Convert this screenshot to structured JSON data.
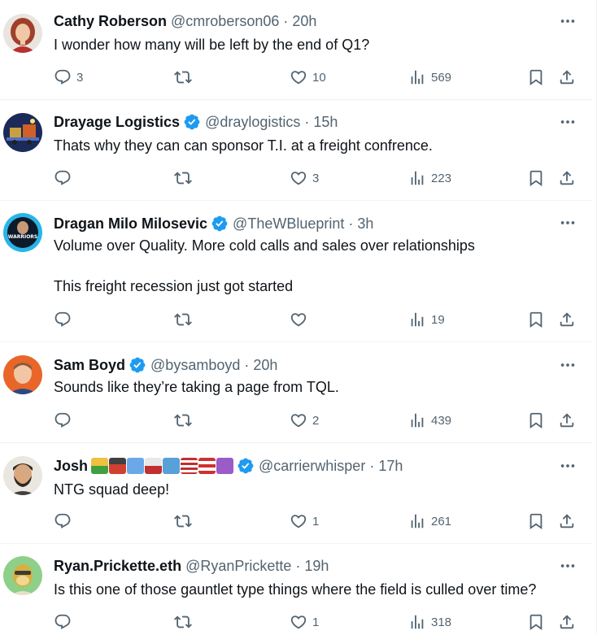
{
  "tweets": [
    {
      "name": "Cathy Roberson",
      "handle": "@cmroberson06",
      "dot": "·",
      "time": "20h",
      "verified": false,
      "text_lines": [
        "I wonder how many will be left by the end of Q1?"
      ],
      "replies": "3",
      "retweets": "",
      "likes": "10",
      "views": "569",
      "avatar": "woman-red-hair-avatar"
    },
    {
      "name": "Drayage Logistics",
      "handle": "@draylogistics",
      "dot": "·",
      "time": "15h",
      "verified": true,
      "text_lines": [
        "Thats why they can can sponsor T.I. at a freight confrence."
      ],
      "replies": "",
      "retweets": "",
      "likes": "3",
      "views": "223",
      "avatar": "trucks-night-avatar"
    },
    {
      "name": "Dragan Milo Milosevic",
      "handle": "@TheWBlueprint",
      "dot": "·",
      "time": "3h",
      "verified": true,
      "text_lines": [
        "Volume over Quality. More cold calls and sales over relationships",
        "",
        "This freight recession just got started"
      ],
      "replies": "",
      "retweets": "",
      "likes": "",
      "views": "19",
      "avatar": "warriors-blueprint-avatar"
    },
    {
      "name": "Sam Boyd",
      "handle": "@bysamboyd",
      "dot": "·",
      "time": "20h",
      "verified": true,
      "text_lines": [
        "Sounds like they’re taking a page from TQL."
      ],
      "replies": "",
      "retweets": "",
      "likes": "2",
      "views": "439",
      "avatar": "man-orange-background-avatar"
    },
    {
      "name": "Josh",
      "handle": "@carrierwhisper",
      "dot": "·",
      "time": "17h",
      "verified": true,
      "emoji": [
        "truck",
        "train",
        "airplane",
        "ship",
        "robot",
        "us-flag",
        "puerto-rico-flag",
        "latin-cross"
      ],
      "text_lines": [
        "NTG squad deep!"
      ],
      "replies": "",
      "retweets": "",
      "likes": "1",
      "views": "261",
      "avatar": "bearded-man-cartoon-avatar"
    },
    {
      "name": "Ryan.Prickette.eth",
      "handle": "@RyanPrickette",
      "dot": "·",
      "time": "19h",
      "verified": false,
      "text_lines": [
        "Is this one of those gauntlet type things where the field is culled over time?"
      ],
      "replies": "",
      "retweets": "",
      "likes": "1",
      "views": "318",
      "avatar": "cartoon-ape-avatar"
    }
  ],
  "colors": {
    "text": "#0f1419",
    "muted": "#536471",
    "verified": "#1d9bf0",
    "divider": "#eff3f4"
  },
  "icons": [
    "reply-icon",
    "retweet-icon",
    "like-icon",
    "views-icon",
    "bookmark-icon",
    "share-icon",
    "more-icon",
    "verified-badge-icon"
  ]
}
